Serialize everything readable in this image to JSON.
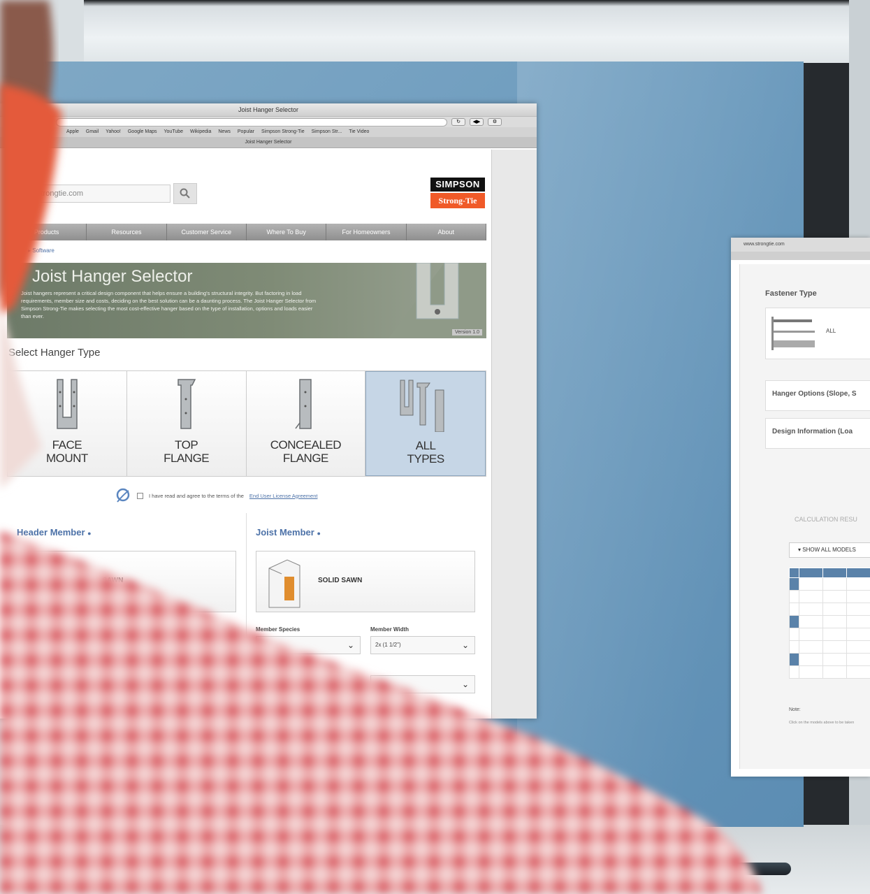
{
  "browser": {
    "window_title": "Joist Hanger Selector",
    "tab_title": "Joist Hanger Selector",
    "bookmarks": [
      "Apple",
      "Gmail",
      "Yahoo!",
      "Google Maps",
      "YouTube",
      "Wikipedia",
      "News",
      "Popular",
      "Simpson Strong-Tie",
      "Simpson Str...",
      "Tie Video"
    ]
  },
  "site": {
    "search_placeholder": "strongtie.com",
    "logo_top": "SIMPSON",
    "logo_bottom": "Strong-Tie",
    "nav": [
      "Products",
      "Resources",
      "Customer Service",
      "Where To Buy",
      "For Homeowners",
      "About"
    ],
    "crumb_last": "Software"
  },
  "banner": {
    "title": "Joist Hanger Selector",
    "text": "Joist hangers represent a critical design component that helps ensure a building's structural integrity. But factoring in load requirements, member size and costs, deciding on the best solution can be a daunting process. The Joist Hanger Selector from Simpson Strong-Tie makes selecting the most cost-effective hanger based on the type of installation, options and loads easier than ever.",
    "version": "Version 1.0"
  },
  "selector": {
    "title": "Select Hanger Type",
    "types": [
      {
        "line1": "FACE",
        "line2": "MOUNT"
      },
      {
        "line1": "TOP",
        "line2": "FLANGE"
      },
      {
        "line1": "CONCEALED",
        "line2": "FLANGE"
      },
      {
        "line1": "ALL",
        "line2": "TYPES"
      }
    ],
    "selected": "ALL TYPES",
    "agree_text": "I have read and agree to the terms of the",
    "agree_link": "End User License Agreement"
  },
  "members": {
    "header_title": "Header Member",
    "header_label": "SOLID SAWN",
    "joist_title": "Joist Member",
    "joist_label": "SOLID SAWN",
    "species_label": "Member Species",
    "width_label": "Member Width",
    "width_value": "2x (1 1/2\")"
  },
  "window2": {
    "url": "www.strongtie.com",
    "fastener_title": "Fastener Type",
    "fastener_all": "ALL",
    "options_title": "Hanger Options (Slope, S",
    "design_title": "Design Information (Loa",
    "calc_results": "CALCULATION RESU",
    "show_all": "SHOW ALL MODELS",
    "note_title": "Note:",
    "note_text": "Click on the models above to be taken"
  },
  "colors": {
    "accent_blue": "#4d72a8",
    "logo_orange": "#f05a28",
    "selected_card": "#c6d6e6"
  }
}
